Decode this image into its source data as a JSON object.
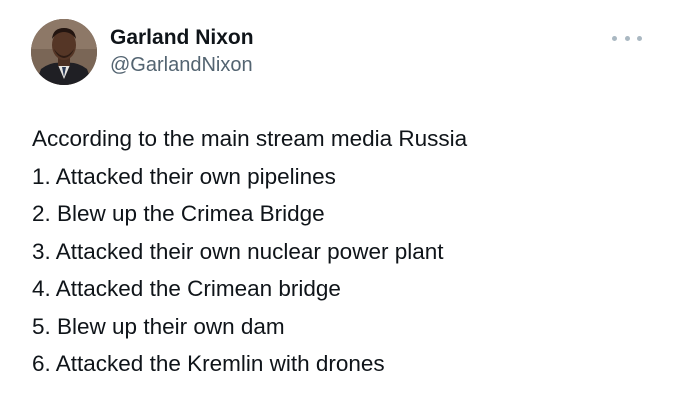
{
  "author": {
    "display_name": "Garland Nixon",
    "handle": "@GarlandNixon"
  },
  "tweet": {
    "lines": [
      "According to the main stream media Russia",
      "1. Attacked their own pipelines",
      "2. Blew up the Crimea Bridge",
      "3. Attacked their own nuclear power plant",
      "4. Attacked the Crimean bridge",
      "5. Blew up their own dam",
      "6. Attacked the Kremlin with drones"
    ]
  },
  "icons": {
    "more": "more-options-icon",
    "avatar": "profile-avatar"
  },
  "colors": {
    "text": "#0f1419",
    "secondary_text": "#536471",
    "more_dots": "#aab8c2",
    "background": "#ffffff"
  }
}
